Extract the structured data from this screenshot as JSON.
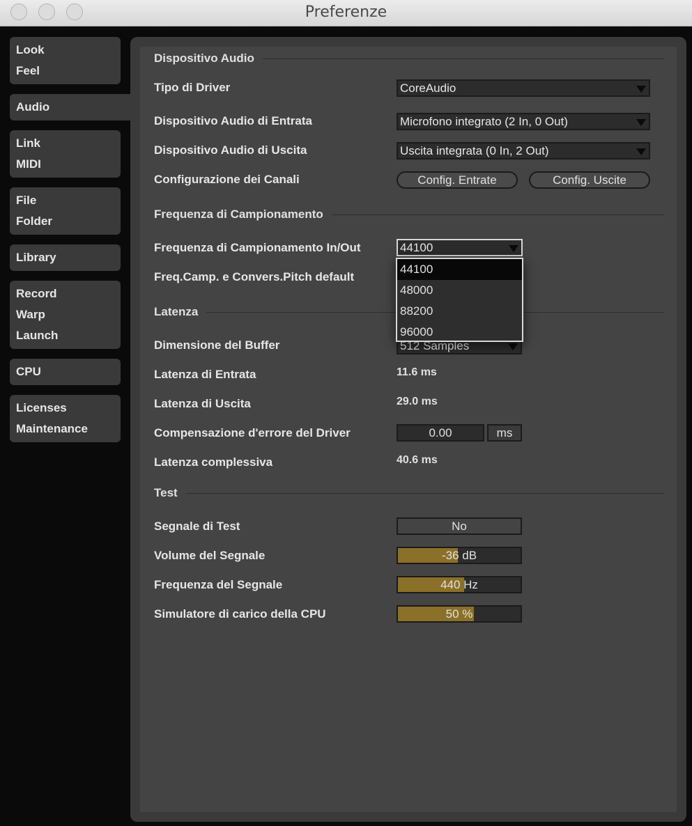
{
  "window": {
    "title": "Preferenze"
  },
  "sidebar": {
    "tabs": [
      [
        "Look",
        "Feel"
      ],
      [
        "Audio"
      ],
      [
        "Link",
        "MIDI"
      ],
      [
        "File",
        "Folder"
      ],
      [
        "Library"
      ],
      [
        "Record",
        "Warp",
        "Launch"
      ],
      [
        "CPU"
      ],
      [
        "Licenses",
        "Maintenance"
      ]
    ],
    "active": "Audio"
  },
  "audio_device": {
    "section": "Dispositivo Audio",
    "driver_label": "Tipo di Driver",
    "driver_value": "CoreAudio",
    "input_label": "Dispositivo Audio di Entrata",
    "input_value": "Microfono integrato (2 In, 0 Out)",
    "output_label": "Dispositivo Audio di Uscita",
    "output_value": "Uscita integrata (0 In, 2 Out)",
    "channels_label": "Configurazione dei Canali",
    "config_in": "Config. Entrate",
    "config_out": "Config. Uscite"
  },
  "sample_rate": {
    "section": "Frequenza di Campionamento",
    "inout_label": "Frequenza di Campionamento In/Out",
    "inout_value": "44100",
    "pitch_label": "Freq.Camp. e Convers.Pitch default",
    "options": [
      "44100",
      "48000",
      "88200",
      "96000"
    ],
    "selected": "44100"
  },
  "latency": {
    "section": "Latenza",
    "buffer_label": "Dimensione del Buffer",
    "buffer_value": "512 Samples",
    "in_label": "Latenza di Entrata",
    "in_value": "11.6 ms",
    "out_label": "Latenza di Uscita",
    "out_value": "29.0 ms",
    "comp_label": "Compensazione d'errore del Driver",
    "comp_value": "0.00",
    "comp_unit": "ms",
    "total_label": "Latenza complessiva",
    "total_value": "40.6 ms"
  },
  "test": {
    "section": "Test",
    "signal_label": "Segnale di Test",
    "signal_value": "No",
    "volume_label": "Volume del Segnale",
    "volume_value": "-36 dB",
    "volume_fill": 0.49,
    "freq_label": "Frequenza del Segnale",
    "freq_value": "440 Hz",
    "freq_fill": 0.54,
    "cpu_label": "Simulatore di carico della CPU",
    "cpu_value": "50 %",
    "cpu_fill": 0.62
  },
  "colors": {
    "accent_fill": "#8b7029",
    "panel": "#444444"
  }
}
